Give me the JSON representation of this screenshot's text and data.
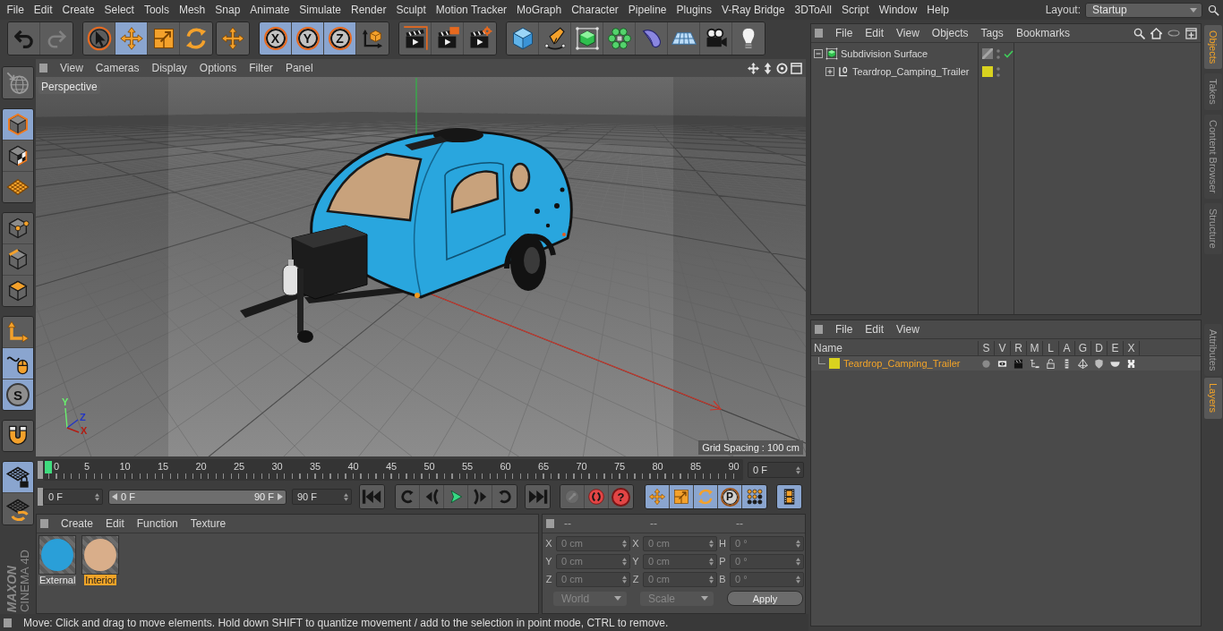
{
  "menu_bar": {
    "items": [
      "File",
      "Edit",
      "Create",
      "Select",
      "Tools",
      "Mesh",
      "Snap",
      "Animate",
      "Simulate",
      "Render",
      "Sculpt",
      "Motion Tracker",
      "MoGraph",
      "Character",
      "Pipeline",
      "Plugins",
      "V-Ray Bridge",
      "3DToAll",
      "Script",
      "Window",
      "Help"
    ],
    "layout": {
      "label": "Layout:",
      "value": "Startup"
    }
  },
  "toolbar": {
    "groups": [
      {
        "buttons": [
          {
            "kind": "undo",
            "selected": false,
            "disabled": false
          },
          {
            "kind": "redo",
            "selected": false,
            "disabled": true
          }
        ]
      },
      {
        "buttons": [
          {
            "kind": "pointer",
            "selected": false,
            "disabled": false
          },
          {
            "kind": "move",
            "selected": true,
            "disabled": false
          },
          {
            "kind": "scale",
            "selected": false,
            "disabled": false
          },
          {
            "kind": "rotate",
            "selected": false,
            "disabled": false
          }
        ]
      },
      {
        "buttons": [
          {
            "kind": "move",
            "selected": false,
            "disabled": false
          }
        ]
      },
      {
        "buttons": [
          {
            "kind": "axis",
            "label": "X",
            "selected": true,
            "disabled": false
          },
          {
            "kind": "axis",
            "label": "Y",
            "selected": true,
            "disabled": false
          },
          {
            "kind": "axis",
            "label": "Z",
            "selected": true,
            "disabled": false
          },
          {
            "kind": "coordinates",
            "selected": false,
            "disabled": false
          }
        ]
      },
      {
        "buttons": [
          {
            "kind": "renderview",
            "selected": false,
            "disabled": false
          },
          {
            "kind": "renderpicture",
            "selected": false,
            "disabled": false
          },
          {
            "kind": "rendersettings",
            "selected": false,
            "disabled": false
          }
        ]
      },
      {
        "buttons": [
          {
            "kind": "cube",
            "selected": false,
            "disabled": false
          },
          {
            "kind": "pen",
            "selected": false,
            "disabled": false
          },
          {
            "kind": "subdivision",
            "selected": false,
            "disabled": false
          },
          {
            "kind": "cloner",
            "selected": false,
            "disabled": false
          },
          {
            "kind": "deformer",
            "selected": false,
            "disabled": false
          },
          {
            "kind": "floor",
            "selected": false,
            "disabled": false
          },
          {
            "kind": "camera",
            "selected": false,
            "disabled": false
          },
          {
            "kind": "light",
            "selected": false,
            "disabled": false
          }
        ]
      }
    ]
  },
  "mode_toolbar": {
    "groups": [
      {
        "buttons": [
          {
            "kind": "editable",
            "selected": false,
            "disabled": true
          }
        ]
      },
      {
        "buttons": [
          {
            "kind": "model",
            "selected": true,
            "disabled": false
          },
          {
            "kind": "texture",
            "selected": false,
            "disabled": false
          },
          {
            "kind": "workplane",
            "selected": false,
            "disabled": false
          }
        ]
      },
      {
        "buttons": [
          {
            "kind": "points",
            "selected": false,
            "disabled": false
          },
          {
            "kind": "edges",
            "selected": false,
            "disabled": false
          },
          {
            "kind": "polygons",
            "selected": false,
            "disabled": false
          }
        ]
      },
      {
        "buttons": [
          {
            "kind": "axes",
            "selected": false,
            "disabled": false
          },
          {
            "kind": "tweak",
            "selected": true,
            "disabled": false
          },
          {
            "kind": "snap",
            "label": "S",
            "selected": true,
            "disabled": false
          }
        ]
      },
      {
        "buttons": [
          {
            "kind": "magnet",
            "selected": false,
            "disabled": false
          }
        ]
      },
      {
        "buttons": [
          {
            "kind": "gridlock",
            "selected": true,
            "disabled": false
          },
          {
            "kind": "gridrotate",
            "selected": false,
            "disabled": false
          }
        ]
      }
    ]
  },
  "viewport": {
    "menu": [
      "View",
      "Cameras",
      "Display",
      "Options",
      "Filter",
      "Panel"
    ],
    "camera": "Perspective",
    "grid_spacing": "Grid Spacing : 100 cm",
    "axes": [
      {
        "label": "Y",
        "color": "#6af06e"
      },
      {
        "label": "Z",
        "color": "#2436c4"
      },
      {
        "label": "X",
        "color": "#b41c12"
      }
    ]
  },
  "timeline": {
    "frames": [
      "0",
      "5",
      "10",
      "15",
      "20",
      "25",
      "30",
      "35",
      "40",
      "45",
      "50",
      "55",
      "60",
      "65",
      "70",
      "75",
      "80",
      "85",
      "90"
    ],
    "level": 0,
    "current_frame": "0 F"
  },
  "transport": {
    "start_field": "0 F",
    "range": {
      "start": "0 F",
      "end": "90 F",
      "level": 1
    },
    "end_field": "90 F",
    "groups": [
      {
        "buttons": [
          {
            "kind": "first",
            "selected": false,
            "disabled": false
          }
        ]
      },
      {
        "buttons": [
          {
            "kind": "prevkey",
            "selected": false,
            "disabled": false
          },
          {
            "kind": "prevframe",
            "selected": false,
            "disabled": false
          },
          {
            "kind": "play",
            "selected": false,
            "disabled": false
          },
          {
            "kind": "nextframe",
            "selected": false,
            "disabled": false
          },
          {
            "kind": "nextkey",
            "selected": false,
            "disabled": false
          }
        ]
      },
      {
        "buttons": [
          {
            "kind": "last",
            "selected": false,
            "disabled": false
          }
        ]
      },
      {
        "buttons": [
          {
            "kind": "record",
            "selected": false,
            "disabled": true
          },
          {
            "kind": "autokey",
            "selected": false,
            "disabled": false
          },
          {
            "kind": "keyframe",
            "label": "?",
            "selected": false,
            "disabled": false
          }
        ]
      },
      {
        "buttons": [
          {
            "kind": "keymove",
            "selected": true,
            "disabled": false
          },
          {
            "kind": "keyscale",
            "selected": true,
            "disabled": false
          },
          {
            "kind": "keyrotate",
            "selected": true,
            "disabled": false
          },
          {
            "kind": "keyparam",
            "label": "P",
            "selected": true,
            "disabled": false
          },
          {
            "kind": "keypla",
            "selected": true,
            "disabled": false
          }
        ]
      },
      {
        "buttons": [
          {
            "kind": "timeline",
            "selected": true,
            "disabled": false
          }
        ]
      }
    ]
  },
  "materials": {
    "menu": [
      "Create",
      "Edit",
      "Function",
      "Texture"
    ],
    "items": [
      {
        "name": "External",
        "color": "#2a9fd8",
        "selected": false
      },
      {
        "name": "Interior",
        "color": "#d9ae8a",
        "selected": true
      }
    ]
  },
  "coordinates": {
    "columns": [
      {
        "header": "--",
        "fields": [
          {
            "label": "X",
            "value": "0 cm",
            "disabled": true
          },
          {
            "label": "Y",
            "value": "0 cm",
            "disabled": true
          },
          {
            "label": "Z",
            "value": "0 cm",
            "disabled": true
          }
        ]
      },
      {
        "header": "--",
        "fields": [
          {
            "label": "X",
            "value": "0 cm",
            "disabled": true
          },
          {
            "label": "Y",
            "value": "0 cm",
            "disabled": true
          },
          {
            "label": "Z",
            "value": "0 cm",
            "disabled": true
          }
        ]
      },
      {
        "header": "--",
        "fields": [
          {
            "label": "H",
            "value": "0 °",
            "disabled": true
          },
          {
            "label": "P",
            "value": "0 °",
            "disabled": true
          },
          {
            "label": "B",
            "value": "0 °",
            "disabled": true
          }
        ]
      }
    ],
    "dropdowns": [
      {
        "value": "World",
        "disabled": true
      },
      {
        "value": "Scale",
        "disabled": true
      }
    ],
    "apply": "Apply"
  },
  "logo": {
    "brand": "MAXON",
    "product": "CINEMA 4D"
  },
  "status_bar": "Move: Click and drag to move elements. Hold down SHIFT to quantize movement / add to the selection in point mode, CTRL to remove.",
  "object_manager": {
    "menu": [
      "File",
      "Edit",
      "View",
      "Objects",
      "Tags",
      "Bookmarks"
    ],
    "objects": [
      {
        "name": "Subdivision Surface",
        "kind": "subdivision",
        "selected": false,
        "expanded": true,
        "enabled": true,
        "children": [
          {
            "name": "Teardrop_Camping_Trailer",
            "kind": "null",
            "selected": false,
            "expanded": false,
            "color": "#d9d21f"
          }
        ]
      }
    ]
  },
  "layer_manager": {
    "menu": [
      "File",
      "Edit",
      "View"
    ],
    "columns": [
      "Name",
      "S",
      "V",
      "R",
      "M",
      "L",
      "A",
      "G",
      "D",
      "E",
      "X"
    ],
    "layers": [
      {
        "name": "Teardrop_Camping_Trailer",
        "color": "#d9d21f",
        "selected": true
      }
    ]
  },
  "side_tabs": {
    "top": [
      {
        "label": "Objects",
        "selected": true
      },
      {
        "label": "Takes",
        "selected": false
      },
      {
        "label": "Content Browser",
        "selected": false
      },
      {
        "label": "Structure",
        "selected": false
      }
    ],
    "bottom": [
      {
        "label": "Attributes",
        "selected": false
      },
      {
        "label": "Layers",
        "selected": true
      }
    ]
  }
}
